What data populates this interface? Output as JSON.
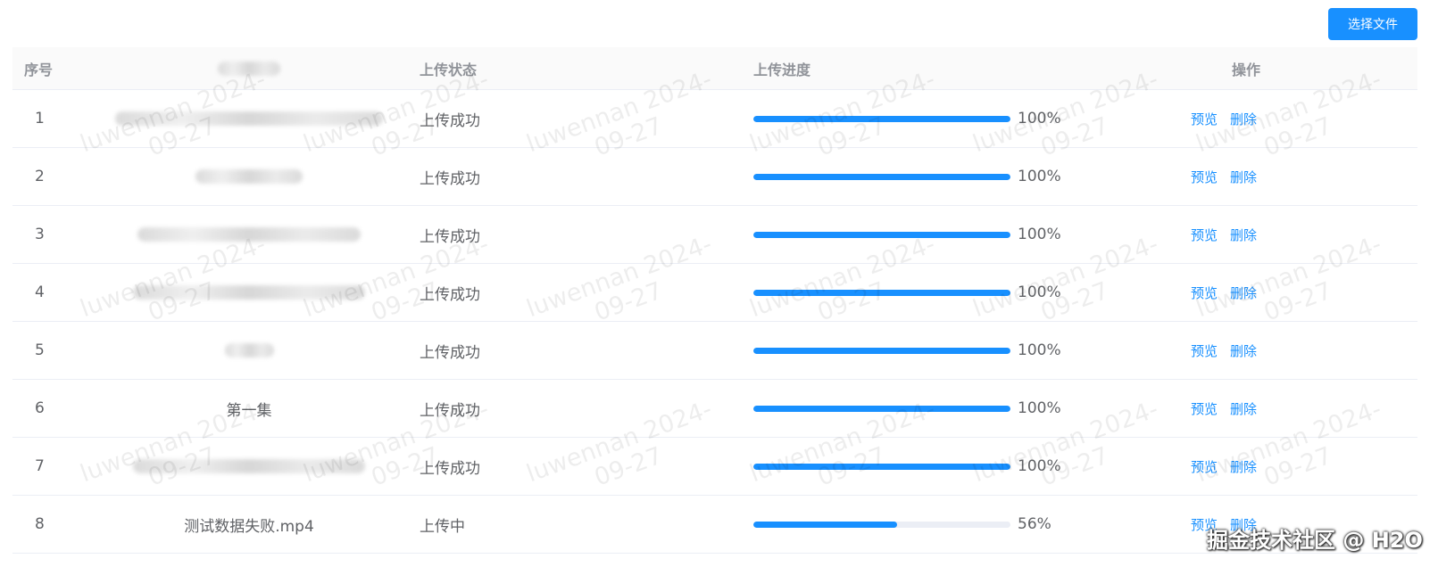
{
  "toolbar": {
    "select_file_label": "选择文件"
  },
  "table": {
    "headers": {
      "index": "序号",
      "status": "上传状态",
      "progress": "上传进度",
      "actions": "操作"
    },
    "rows": [
      {
        "index": "1",
        "name": "",
        "status": "上传成功",
        "progress": 100,
        "progress_label": "100%",
        "preview": "预览",
        "delete": "删除"
      },
      {
        "index": "2",
        "name": "",
        "status": "上传成功",
        "progress": 100,
        "progress_label": "100%",
        "preview": "预览",
        "delete": "删除"
      },
      {
        "index": "3",
        "name": "",
        "status": "上传成功",
        "progress": 100,
        "progress_label": "100%",
        "preview": "预览",
        "delete": "删除"
      },
      {
        "index": "4",
        "name": "",
        "status": "上传成功",
        "progress": 100,
        "progress_label": "100%",
        "preview": "预览",
        "delete": "删除"
      },
      {
        "index": "5",
        "name": "",
        "status": "上传成功",
        "progress": 100,
        "progress_label": "100%",
        "preview": "预览",
        "delete": "删除"
      },
      {
        "index": "6",
        "name": "第一集",
        "status": "上传成功",
        "progress": 100,
        "progress_label": "100%",
        "preview": "预览",
        "delete": "删除"
      },
      {
        "index": "7",
        "name": "",
        "status": "上传成功",
        "progress": 100,
        "progress_label": "100%",
        "preview": "预览",
        "delete": "删除"
      },
      {
        "index": "8",
        "name": "测试数据失败.mp4",
        "status": "上传中",
        "progress": 56,
        "progress_label": "56%",
        "preview": "预览",
        "delete": "删除"
      }
    ]
  },
  "watermark": {
    "line1": "luwennan 2024-",
    "line2": "09-27"
  },
  "credit": "掘金技术社区 @ H2O",
  "colors": {
    "accent": "#1890ff",
    "track": "#ebeef5"
  }
}
